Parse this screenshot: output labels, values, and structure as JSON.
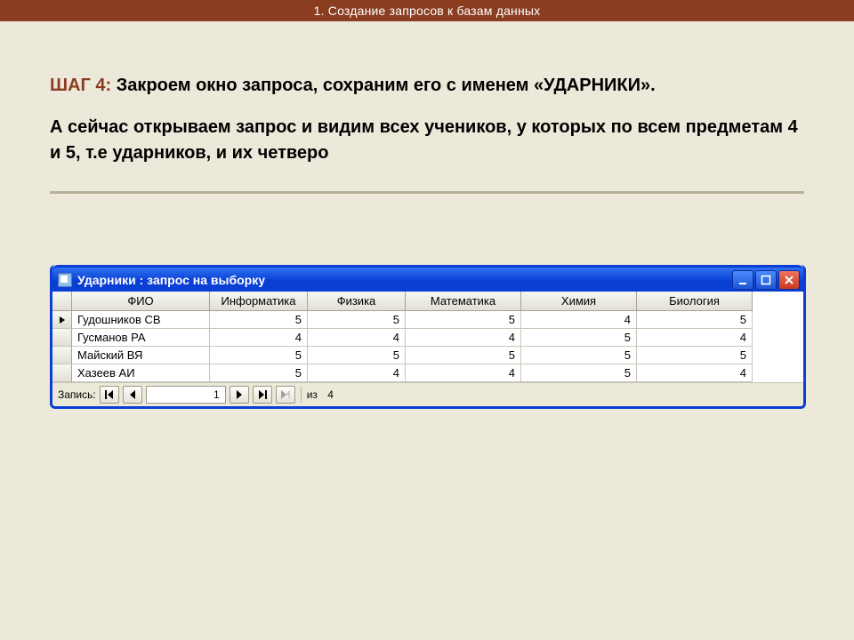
{
  "header": {
    "title": "1. Создание запросов к базам данных"
  },
  "step": {
    "label": "ШАГ 4:",
    "title_rest": " Закроем окно запроса, сохраним его с именем «УДАРНИКИ».",
    "paragraph": " А сейчас открываем запрос и видим всех учеников, у которых по всем предметам 4 и 5, т.е ударников, и их четверо"
  },
  "window": {
    "title": "Ударники : запрос на выборку"
  },
  "grid": {
    "columns": [
      "ФИО",
      "Информатика",
      "Физика",
      "Математика",
      "Химия",
      "Биология"
    ],
    "rows": [
      {
        "name": "Гудошников СВ",
        "values": [
          5,
          5,
          5,
          4,
          5
        ],
        "current": true
      },
      {
        "name": "Гусманов РА",
        "values": [
          4,
          4,
          4,
          5,
          4
        ],
        "current": false
      },
      {
        "name": "Майский ВЯ",
        "values": [
          5,
          5,
          5,
          5,
          5
        ],
        "current": false
      },
      {
        "name": "Хазеев АИ",
        "values": [
          5,
          4,
          4,
          5,
          4
        ],
        "current": false
      }
    ]
  },
  "nav": {
    "label": "Запись:",
    "current": "1",
    "of_label": "из",
    "total": "4"
  }
}
